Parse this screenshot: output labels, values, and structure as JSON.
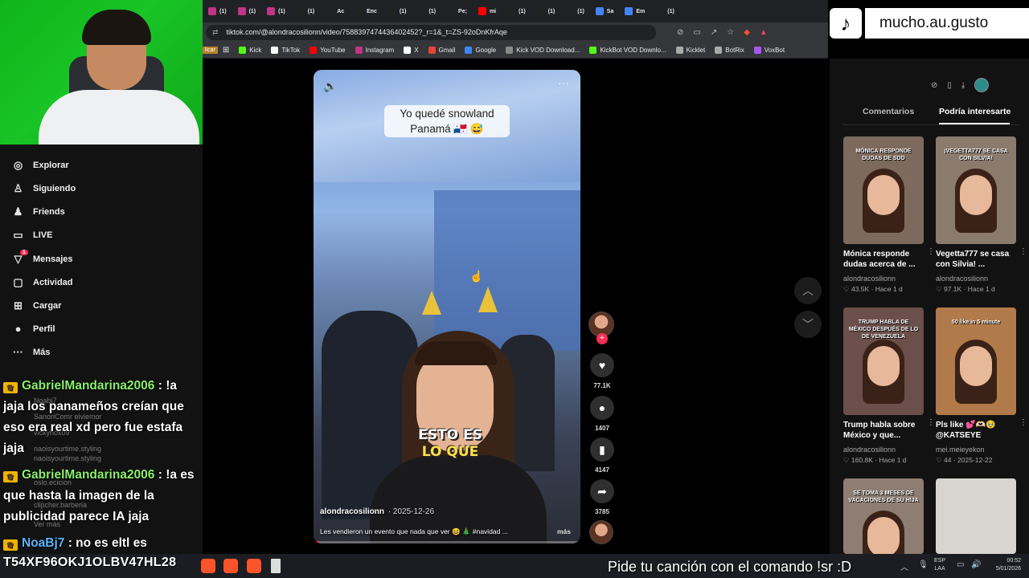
{
  "browser": {
    "tabs": [
      {
        "icon_color": "#c13584",
        "text": "(1)"
      },
      {
        "icon_color": "#c13584",
        "text": "(1)"
      },
      {
        "icon_color": "#c13584",
        "text": "(1)"
      },
      {
        "icon_color": "#222222",
        "text": "(1)"
      },
      {
        "icon_color": "#222222",
        "text": "Ас"
      },
      {
        "icon_color": "#222222",
        "text": "Епс"
      },
      {
        "icon_color": "#222222",
        "text": "(1)"
      },
      {
        "icon_color": "#222222",
        "text": "(1)"
      },
      {
        "icon_color": "#222222",
        "text": "Pe;"
      },
      {
        "icon_color": "#ff0000",
        "text": "mi"
      },
      {
        "icon_color": "#222222",
        "text": "(1)"
      },
      {
        "icon_color": "#222222",
        "text": "(1)"
      },
      {
        "icon_color": "#222222",
        "text": "(1)"
      },
      {
        "icon_color": "#4285f4",
        "text": "Sa"
      },
      {
        "icon_color": "#4285f4",
        "text": "Em"
      },
      {
        "icon_color": "#222222",
        "text": "(1)"
      }
    ],
    "url": "tiktok.com/@alondracosilionn/video/7588397474436402452?_r=1&_t=ZS-92oDnKfrAqe",
    "bookmarks": [
      {
        "label": "Kick",
        "color": "#53fc18"
      },
      {
        "label": "TikTok",
        "color": "#ffffff"
      },
      {
        "label": "YouTube",
        "color": "#ff0000"
      },
      {
        "label": "Instagram",
        "color": "#c13584"
      },
      {
        "label": "X",
        "color": "#ffffff"
      },
      {
        "label": "Gmail",
        "color": "#ea4335"
      },
      {
        "label": "Google",
        "color": "#4285f4"
      },
      {
        "label": "Kick VOD Download...",
        "color": "#888888"
      },
      {
        "label": "KickBot VOD Downlo...",
        "color": "#53fc18"
      },
      {
        "label": "Kicklet",
        "color": "#aaaaaa"
      },
      {
        "label": "BotRix",
        "color": "#aaaaaa"
      },
      {
        "label": "VoxBot",
        "color": "#a855f7"
      }
    ],
    "bookmark_prefix": "licar"
  },
  "watermark": {
    "handle": "mucho.au.gusto"
  },
  "nav": {
    "items": [
      {
        "label": "Explorar",
        "icon": "compass-icon",
        "glyph": "◎"
      },
      {
        "label": "Siguiendo",
        "icon": "following-icon",
        "glyph": "♙"
      },
      {
        "label": "Friends",
        "icon": "friends-icon",
        "glyph": "♟"
      },
      {
        "label": "LIVE",
        "icon": "live-icon",
        "glyph": "▭"
      },
      {
        "label": "Mensajes",
        "icon": "messages-icon",
        "glyph": "▽"
      },
      {
        "label": "Actividad",
        "icon": "activity-icon",
        "glyph": "▢"
      },
      {
        "label": "Cargar",
        "icon": "upload-icon",
        "glyph": "⊞"
      },
      {
        "label": "Perfil",
        "icon": "profile-icon",
        "glyph": "●"
      },
      {
        "label": "Más",
        "icon": "more-icon",
        "glyph": "···"
      }
    ],
    "messages_badge": "1"
  },
  "chat": {
    "ghost_lines": [
      "Noabj7",
      "SanoriComr elviemor",
      "vickyhox09",
      "naoisyourtime.styling",
      "naoisyourtime.styling",
      "oslo.ecicion",
      "clipcher.barberia",
      "Ver más"
    ],
    "messages": [
      {
        "user": "GabrielMandarina2006",
        "text": " : !a jaja los panameños creían que eso era real xd pero fue estafa jaja",
        "color": "green"
      },
      {
        "user": "GabrielMandarina2006",
        "text": " : !a es que hasta la imagen de la publicidad parece IA jaja",
        "color": "green"
      },
      {
        "user": "NoaBj7",
        "text": " : no es eltl es",
        "color": "blue"
      }
    ]
  },
  "video": {
    "caption_line1": "Yo quedé snowland",
    "caption_line2": "Panamá 🇵🇦 😅",
    "subtitle_line1": "ESTO ES",
    "subtitle_line2": "LO QUE",
    "author": "alondracosilionn",
    "date": "· 2025-12-26",
    "description": "Les vendieron un evento que nada que ver 😆 🎄 #navidad ...",
    "more_label": "más",
    "progress": 0.02
  },
  "actions": {
    "likes": "77.1K",
    "comments": "1407",
    "saves": "4147",
    "shares": "3785"
  },
  "right_panel": {
    "tabs": [
      "Comentarios",
      "Podría interesarte"
    ],
    "active_tab": 1,
    "cards": [
      {
        "title": "Mónica responde dudas acerca de ...",
        "author": "alondracosilionn",
        "likes": "43.5K",
        "when": "Hace 1 d",
        "thumb_text": "MÓNICA RESPONDE DUDAS DE SDD",
        "bg": "#7d6a5c"
      },
      {
        "title": "Vegetta777 se casa con Silvia! ...",
        "author": "alondracosilionn",
        "likes": "97.1K",
        "when": "Hace 1 d",
        "thumb_text": "¡VEGETTA777 SE CASA CON SILVIA!",
        "bg": "#8a7b6d"
      },
      {
        "title": "Trump habla sobre México y que...",
        "author": "alondracosilionn",
        "likes": "160.8K",
        "when": "Hace 1 d",
        "thumb_text": "TRUMP HABLA DE MÉXICO DESPUÉS DE LO DE VENEZUELA",
        "bg": "#6b4f4a"
      },
      {
        "title": "Pls like 💕🫶🏻🥹 @KATSEYE",
        "author": "mei.meieyekon",
        "likes": "44",
        "when": "2025-12-22",
        "thumb_text": "50 like in 5 minute",
        "bg": "#b07a4a"
      },
      {
        "title": "",
        "author": "",
        "likes": "",
        "when": "",
        "thumb_text": "SE TOMA 3 MESES DE VACACIONES DE SU HIJA",
        "bg": "#8d7d72"
      },
      {
        "title": "",
        "author": "",
        "likes": "",
        "when": "",
        "thumb_text": "",
        "bg": "#d8d4d0"
      }
    ]
  },
  "taskbar": {
    "stream_code": "T54XF96OKJ1OLBV47HL28",
    "song_request": "Pide tu canción con el comando !sr :D",
    "lang_line1": "ESP",
    "lang_line2": "LAA",
    "time": "00:52",
    "date": "5/01/2026"
  }
}
